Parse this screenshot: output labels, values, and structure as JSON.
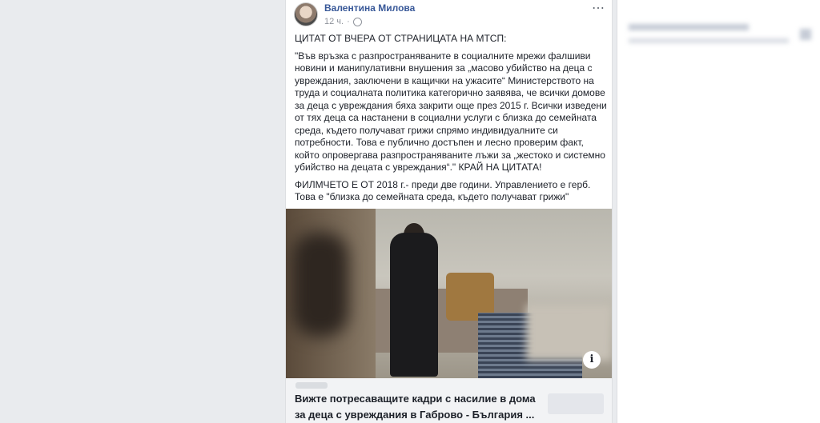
{
  "post": {
    "author": "Валентина Милова",
    "time": "12 ч.",
    "more_icon": "⋯",
    "paragraphs": [
      "ЦИТАТ ОТ ВЧЕРА ОТ СТРАНИЦАТА НА МТСП:",
      "\"Във връзка с разпространяваните в социалните мрежи фалшиви новини и манипулативни внушения за „масово убийство на деца с увреждания, заключени в кащички на ужасите“ Министерството на труда и социалната политика категорично заявява, че всички домове за деца с увреждания бяха закрити още през 2015 г. Всички изведени от тях деца са настанени в социални услуги с близка до семейната среда, където получават грижи спрямо индивидуалните си потребности. Това е публично достъпен и лесно проверим факт, който опровергава разпространяваните лъжи за „жестоко и системно убийство на децата с увреждания“.\" КРАЙ НА ЦИТАТА!",
      "ФИЛМЧЕТО Е ОТ 2018 г.- преди две години. Управлението е герб. Това е \"близка до семейната среда, където получават грижи\""
    ]
  },
  "link": {
    "title": "Вижте потресаващите кадри с насилие в дома за деца с увреждания в Габрово - България ...",
    "info_icon": "i"
  }
}
